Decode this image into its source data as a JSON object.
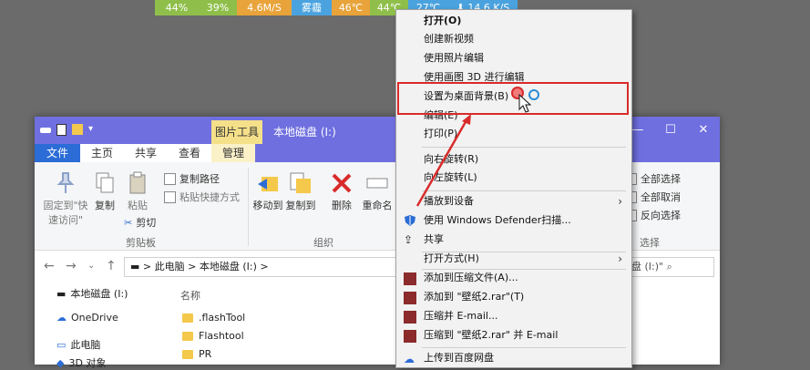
{
  "status_bar": [
    "44%",
    "39%",
    "4.6M/S",
    "雾霾",
    "46℃",
    "44℃",
    "27℃",
    "14.6 K/S"
  ],
  "explorer": {
    "picture_tools": "图片工具",
    "title": "本地磁盘 (I:)",
    "controls": {
      "minimize": "—",
      "maximize": "☐",
      "close": "✕"
    },
    "tabs": [
      "文件",
      "主页",
      "共享",
      "查看",
      "管理"
    ],
    "ribbon": {
      "pin_label": "固定到\"快\n速访问\"",
      "copy": "复制",
      "paste": "粘贴",
      "copy_path": "复制路径",
      "paste_shortcut": "粘贴快捷方式",
      "cut": "剪切",
      "clipboard_group": "剪贴板",
      "move_to": "移动到",
      "copy_to": "复制到",
      "delete": "删除",
      "rename": "重命名",
      "organize_group": "组织",
      "select_all": "全部选择",
      "select_none": "全部取消",
      "invert_selection": "反向选择",
      "select_group": "选择"
    },
    "address": {
      "path_this_pc": "此电脑",
      "path_drive": "本地磁盘 (I:)",
      "search_placeholder": "盘 (I:)\""
    },
    "nav_items": [
      "本地磁盘 (I:)",
      "OneDrive",
      "此电脑",
      "3D 对象"
    ],
    "column_name": "名称",
    "files": [
      ".flashTool",
      "Flashtool",
      "PR"
    ]
  },
  "context_menu": {
    "items": [
      "打开(O)",
      "创建新视频",
      "使用照片编辑",
      "使用画图 3D 进行编辑",
      "设置为桌面背景(B)",
      "编辑(E)",
      "打印(P)",
      "向右旋转(R)",
      "向左旋转(L)",
      "播放到设备",
      "使用 Windows Defender扫描...",
      "共享",
      "打开方式(H)",
      "添加到压缩文件(A)...",
      "添加到 \"壁纸2.rar\"(T)",
      "压缩并 E-mail...",
      "压缩到 \"壁纸2.rar\" 并 E-mail",
      "上传到百度网盘"
    ]
  },
  "colors": {
    "title_bar": "#6f6fe0",
    "file_tab": "#2b6cd6",
    "highlight": "#d92b2b"
  }
}
